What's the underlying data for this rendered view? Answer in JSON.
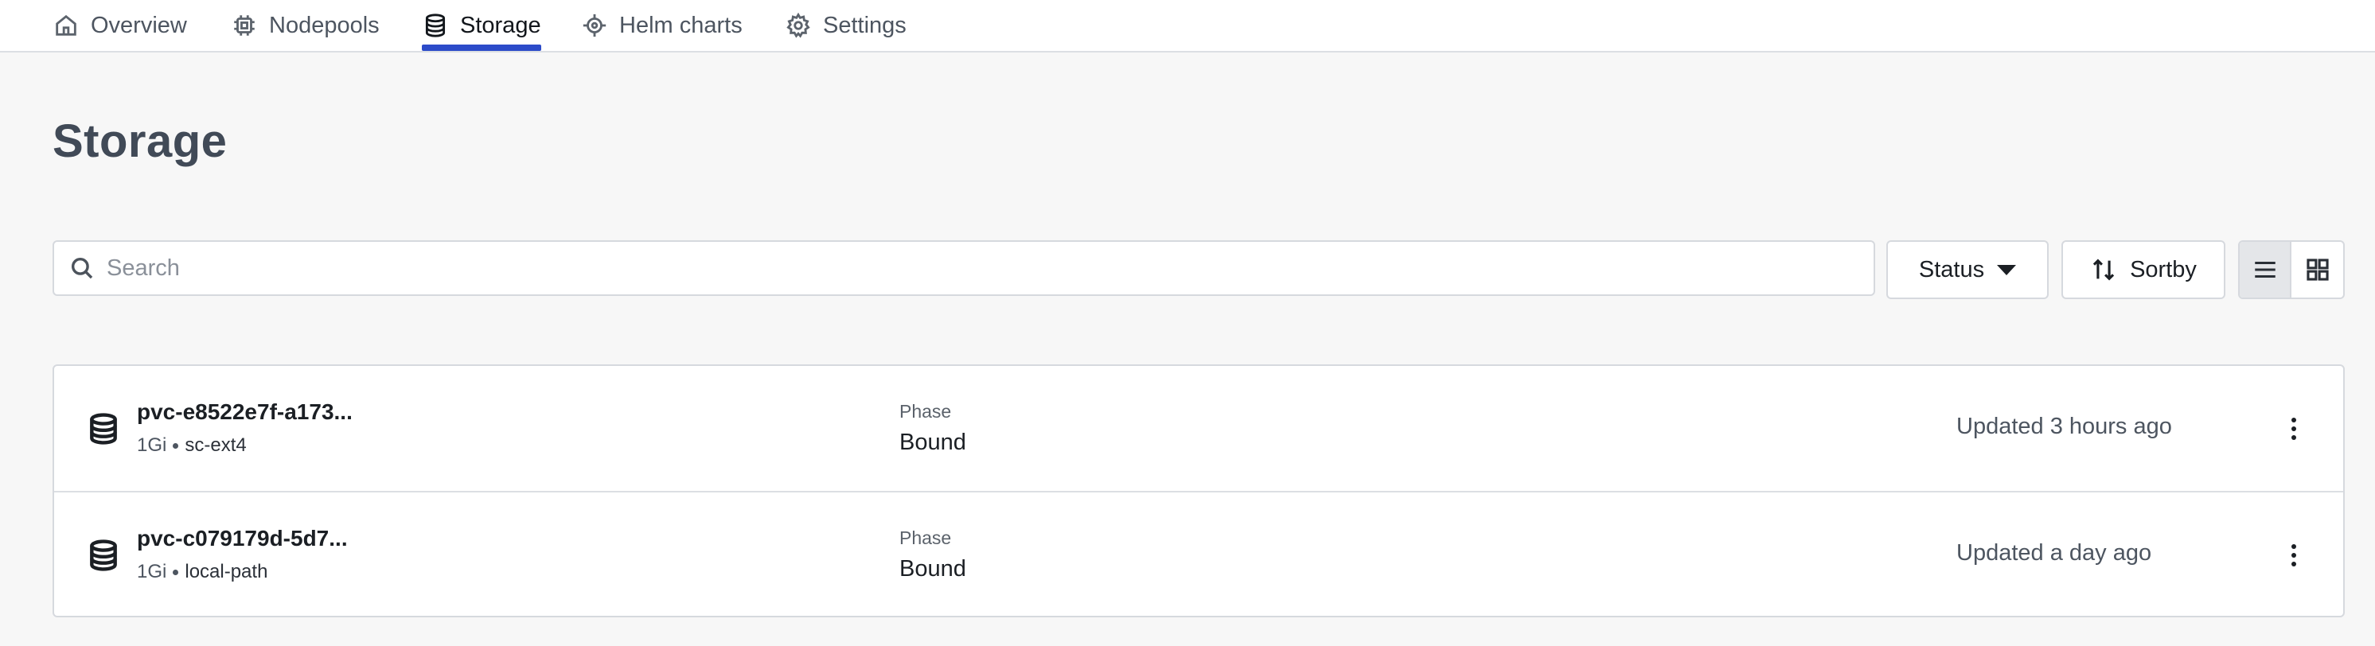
{
  "tabs": [
    {
      "label": "Overview",
      "icon": "home-icon",
      "active": false
    },
    {
      "label": "Nodepools",
      "icon": "chip-icon",
      "active": false
    },
    {
      "label": "Storage",
      "icon": "database-icon",
      "active": true
    },
    {
      "label": "Helm charts",
      "icon": "helm-icon",
      "active": false
    },
    {
      "label": "Settings",
      "icon": "gear-icon",
      "active": false
    }
  ],
  "page": {
    "title": "Storage"
  },
  "toolbar": {
    "search_placeholder": "Search",
    "search_value": "",
    "status_label": "Status",
    "sort_label": "Sortby",
    "view_mode": "list"
  },
  "rows": [
    {
      "name": "pvc-e8522e7f-a173...",
      "size": "1Gi",
      "storage_class": "sc-ext4",
      "phase_label": "Phase",
      "phase": "Bound",
      "updated": "Updated 3 hours ago"
    },
    {
      "name": "pvc-c079179d-5d7...",
      "size": "1Gi",
      "storage_class": "local-path",
      "phase_label": "Phase",
      "phase": "Bound",
      "updated": "Updated a day ago"
    }
  ],
  "colors": {
    "accent": "#2c4bc9",
    "background": "#f7f7f7",
    "title": "#414a57"
  }
}
